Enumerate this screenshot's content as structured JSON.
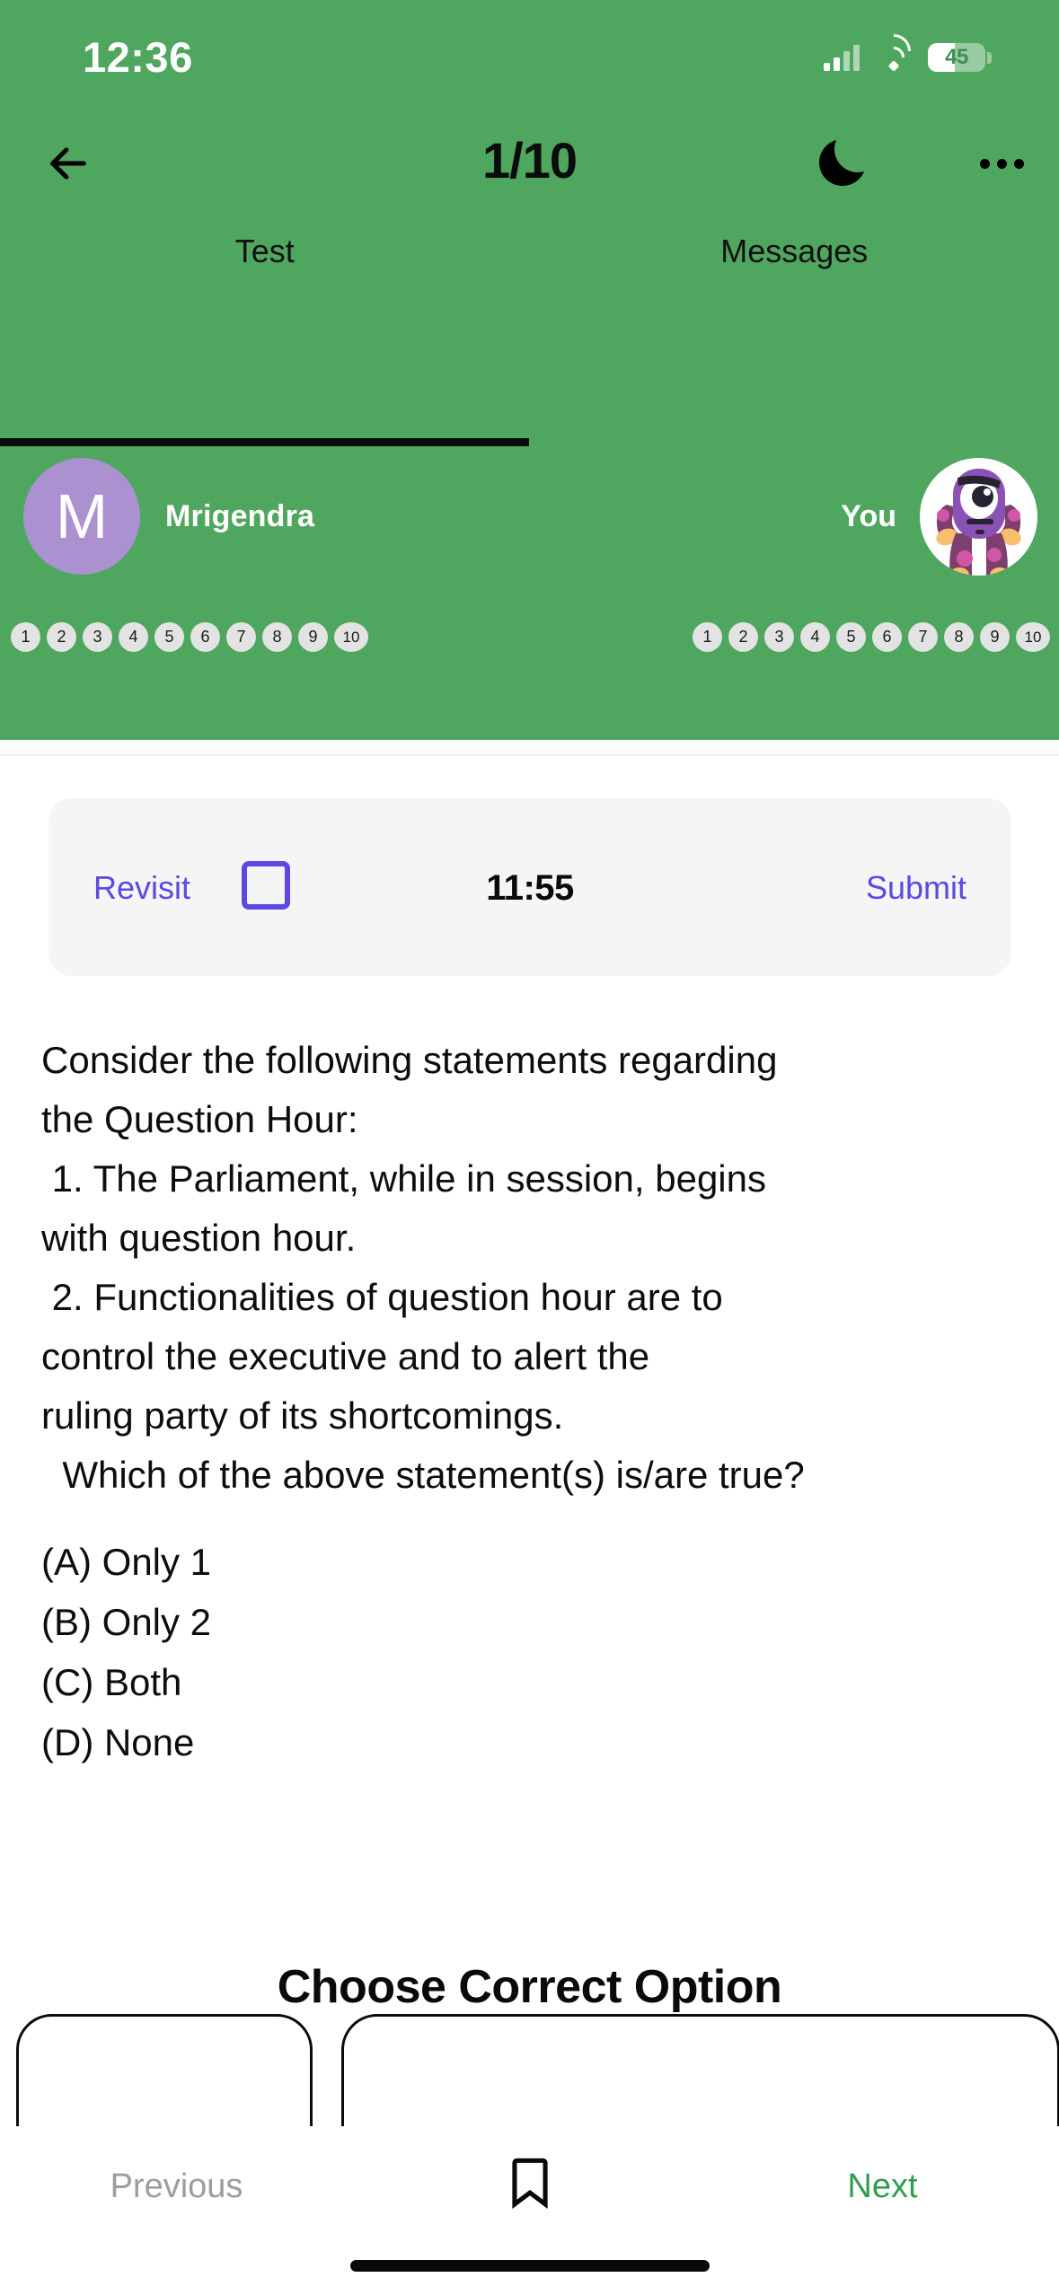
{
  "status_bar": {
    "time": "12:36",
    "battery_percent": "45",
    "icons": [
      "cellular-signal-icon",
      "wifi-icon",
      "battery-icon"
    ]
  },
  "header": {
    "back_icon": "arrow-left-icon",
    "page_count": "1/10",
    "moon_icon": "moon-icon",
    "more_icon": "more-options-icon",
    "accent_green": "#4fa65f"
  },
  "tabs": [
    {
      "label": "Test",
      "active": true
    },
    {
      "label": "Messages",
      "active": false
    }
  ],
  "players": {
    "opponent": {
      "name": "Mrigendra",
      "avatar_initial": "M",
      "avatar_color": "#ab91d0",
      "question_pills": [
        "1",
        "2",
        "3",
        "4",
        "5",
        "6",
        "7",
        "8",
        "9",
        "10"
      ]
    },
    "self": {
      "name": "You",
      "avatar_icon": "cyclops-monster-avatar",
      "question_pills": [
        "1",
        "2",
        "3",
        "4",
        "5",
        "6",
        "7",
        "8",
        "9",
        "10"
      ]
    }
  },
  "control_card": {
    "revisit_label": "Revisit",
    "revisit_checked": false,
    "timer": "11:55",
    "submit_label": "Submit",
    "accent_purple": "#5a4ae3"
  },
  "question": {
    "lines": [
      "Consider the following statements regarding",
      "the Question Hour:",
      " 1. The Parliament, while in session, begins",
      "with question hour.",
      " 2. Functionalities of question hour are to",
      "control the executive and to alert the",
      "ruling party of its shortcomings.",
      "  Which of the above statement(s) is/are true?"
    ],
    "options": [
      "(A) Only 1",
      "(B) Only 2",
      "(C) Both",
      "(D) None"
    ]
  },
  "choose_prompt": "Choose Correct Option",
  "answer_cards": [
    {
      "label": ""
    },
    {
      "label": ""
    }
  ],
  "bottom_nav": {
    "previous_label": "Previous",
    "previous_color": "#9d9d9d",
    "bookmark_icon": "bookmark-icon",
    "next_label": "Next",
    "next_color": "#2f9e4f"
  }
}
